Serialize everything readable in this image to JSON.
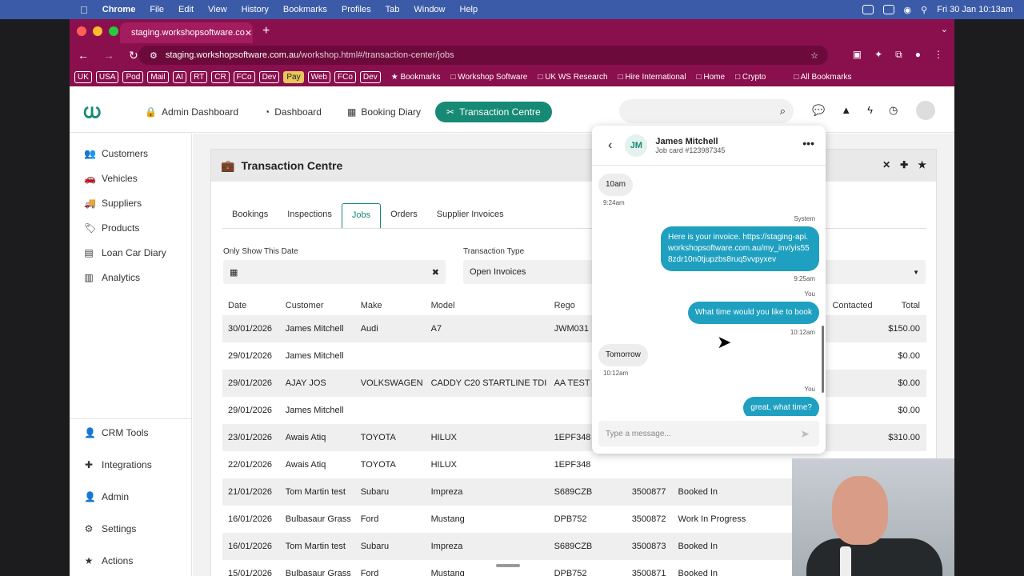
{
  "macmenu": {
    "apple": "",
    "app": "Chrome",
    "items": [
      "File",
      "Edit",
      "View",
      "History",
      "Bookmarks",
      "Profiles",
      "Tab",
      "Window",
      "Help"
    ],
    "clock": "Fri 30 Jan  10:13am"
  },
  "browser": {
    "tab_title": "staging.workshopsoftware.co",
    "url_host": "staging.workshopsoftware.com.au",
    "url_path": "/workshop.html#/transaction-center/jobs",
    "bookmarks": [
      "UK",
      "USA",
      "Pod",
      "Mail",
      "AI",
      "RT",
      "CR",
      "FCo",
      "Dev",
      "Pay",
      "Web",
      "FCo",
      "Dev"
    ],
    "bookmark_folders": [
      "Bookmarks",
      "Workshop Software",
      "UK WS Research",
      "Hire International",
      "Home",
      "Crypto"
    ],
    "all_bookmarks": "All Bookmarks"
  },
  "topnav": {
    "items": [
      "Admin Dashboard",
      "Dashboard",
      "Booking Diary",
      "Transaction Centre"
    ]
  },
  "sidebar": {
    "items": [
      "Customers",
      "Vehicles",
      "Suppliers",
      "Products",
      "Loan Car Diary",
      "Analytics"
    ],
    "bottom": [
      "CRM Tools",
      "Integrations",
      "Admin",
      "Settings",
      "Actions"
    ]
  },
  "panel": {
    "title": "Transaction Centre",
    "tabs": [
      "Bookings",
      "Inspections",
      "Jobs",
      "Orders",
      "Supplier Invoices"
    ],
    "date_label": "Only Show This Date",
    "type_label": "Transaction Type",
    "type_value": "Open Invoices"
  },
  "table": {
    "headers": [
      "Date",
      "Customer",
      "Make",
      "Model",
      "Rego",
      "",
      "",
      "Contacted",
      "Total"
    ],
    "rows": [
      [
        "30/01/2026",
        "James Mitchell",
        "Audi",
        "A7",
        "JWM031",
        "",
        "",
        "",
        "$150.00"
      ],
      [
        "29/01/2026",
        "James Mitchell",
        "",
        "",
        "",
        "",
        "",
        "",
        "$0.00"
      ],
      [
        "29/01/2026",
        "AJAY JOS",
        "VOLKSWAGEN",
        "CADDY C20 STARTLINE TDI",
        "AA TEST",
        "",
        "",
        "",
        "$0.00"
      ],
      [
        "29/01/2026",
        "James Mitchell",
        "",
        "",
        "",
        "",
        "",
        "",
        "$0.00"
      ],
      [
        "23/01/2026",
        "Awais Atiq",
        "TOYOTA",
        "HILUX",
        "1EPF348",
        "",
        "",
        "",
        "$310.00"
      ],
      [
        "22/01/2026",
        "Awais Atiq",
        "TOYOTA",
        "HILUX",
        "1EPF348",
        "",
        "",
        "",
        "$0.00"
      ],
      [
        "21/01/2026",
        "Tom Martin test",
        "Subaru",
        "Impreza",
        "S689CZB",
        "3500877",
        "Booked In",
        "",
        ""
      ],
      [
        "16/01/2026",
        "Bulbasaur Grass",
        "Ford",
        "Mustang",
        "DPB752",
        "3500872",
        "Work In Progress",
        "",
        ""
      ],
      [
        "16/01/2026",
        "Tom Martin test",
        "Subaru",
        "Impreza",
        "S689CZB",
        "3500873",
        "Booked In",
        "",
        ""
      ],
      [
        "15/01/2026",
        "Bulbasaur Grass",
        "Ford",
        "Mustang",
        "DPB752",
        "3500871",
        "Booked In",
        "",
        ""
      ]
    ]
  },
  "chat": {
    "initials": "JM",
    "name": "James Mitchell",
    "sub": "Job card #123987345",
    "m1": "10am",
    "m1_time": "9:24am",
    "m2_sender": "System",
    "m2": "Here is your invoice. https://staging-api.workshopsoftware.com.au/my_inv/yis558zdr10n0tjupzbs8ruq5vvpyxev",
    "m2_time": "9:25am",
    "m3_sender": "You",
    "m3": "What time would you like to book",
    "m3_time": "10:12am",
    "m4": "Tomorrow",
    "m4_time": "10:12am",
    "m5_sender": "You",
    "m5": "great, what time?",
    "placeholder": "Type a message..."
  }
}
